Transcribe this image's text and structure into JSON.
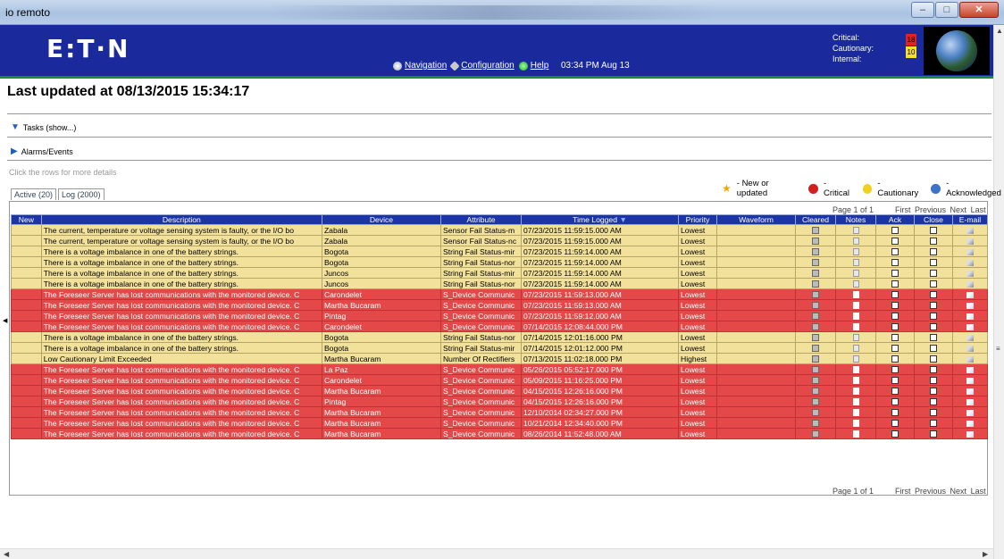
{
  "window": {
    "title": "io remoto"
  },
  "header": {
    "logo": "E:T·N",
    "nav": [
      {
        "label": "Navigation",
        "icon": "navigation-icon"
      },
      {
        "label": "Configuration",
        "icon": "wrench-icon"
      },
      {
        "label": "Help",
        "icon": "help-icon"
      }
    ],
    "clock": "03:34 PM Aug 13",
    "counts": {
      "critical_label": "Critical:",
      "cautionary_label": "Cautionary:",
      "internal_label": "Internal:",
      "critical_value": "18",
      "cautionary_value": "10",
      "critical_color": "#e12222",
      "cautionary_color": "#f5e02a"
    }
  },
  "page": {
    "heading": "Last updated at 08/13/2015 15:34:17",
    "tasks_label": "Tasks (show...)",
    "alarms_label": "Alarms/Events",
    "hint": "Click the rows for more details"
  },
  "legend": {
    "new_label": "- New or updated",
    "critical_label": "- Critical",
    "cautionary_label": "- Cautionary",
    "ack_label": "- Acknowledged",
    "critical_color": "#d21f1f",
    "cautionary_color": "#f0d020",
    "ack_color": "#3c73c8"
  },
  "tabs": [
    {
      "label": "Active (20)"
    },
    {
      "label": "Log (2000)"
    }
  ],
  "pager": {
    "page_text": "Page 1 of 1",
    "first": "First",
    "previous": "Previous",
    "next": "Next",
    "last": "Last"
  },
  "table": {
    "columns": [
      "New",
      "Description",
      "Device",
      "Attribute",
      "Time Logged",
      "Priority",
      "Waveform",
      "Cleared",
      "Notes",
      "Ack",
      "Close",
      "E-mail"
    ],
    "rows": [
      {
        "severity": "caution",
        "description": "The current, temperature or voltage sensing system is faulty, or the I/O bo",
        "device": "Zabala",
        "attribute": "Sensor Fail Status-m",
        "time": "07/23/2015 11:59:15.000 AM",
        "priority": "Lowest"
      },
      {
        "severity": "caution",
        "description": "The current, temperature or voltage sensing system is faulty, or the I/O bo",
        "device": "Zabala",
        "attribute": "Sensor Fail Status-nc",
        "time": "07/23/2015 11:59:15.000 AM",
        "priority": "Lowest"
      },
      {
        "severity": "caution",
        "description": "There is a voltage imbalance in one of the battery strings.",
        "device": "Bogota",
        "attribute": "String Fail Status-mir",
        "time": "07/23/2015 11:59:14.000 AM",
        "priority": "Lowest"
      },
      {
        "severity": "caution",
        "description": "There is a voltage imbalance in one of the battery strings.",
        "device": "Bogota",
        "attribute": "String Fail Status-nor",
        "time": "07/23/2015 11:59:14.000 AM",
        "priority": "Lowest"
      },
      {
        "severity": "caution",
        "description": "There is a voltage imbalance in one of the battery strings.",
        "device": "Juncos",
        "attribute": "String Fail Status-mir",
        "time": "07/23/2015 11:59:14.000 AM",
        "priority": "Lowest"
      },
      {
        "severity": "caution",
        "description": "There is a voltage imbalance in one of the battery strings.",
        "device": "Juncos",
        "attribute": "String Fail Status-nor",
        "time": "07/23/2015 11:59:14.000 AM",
        "priority": "Lowest"
      },
      {
        "severity": "critical",
        "description": "The Foreseer Server has lost communications with the monitored device. C",
        "device": "Carondelet",
        "attribute": "S_Device Communic",
        "time": "07/23/2015 11:59:13.000 AM",
        "priority": "Lowest"
      },
      {
        "severity": "critical",
        "description": "The Foreseer Server has lost communications with the monitored device. C",
        "device": "Martha Bucaram",
        "attribute": "S_Device Communic",
        "time": "07/23/2015 11:59:13.000 AM",
        "priority": "Lowest"
      },
      {
        "severity": "critical",
        "description": "The Foreseer Server has lost communications with the monitored device. C",
        "device": "Pintag",
        "attribute": "S_Device Communic",
        "time": "07/23/2015 11:59:12.000 AM",
        "priority": "Lowest"
      },
      {
        "severity": "critical",
        "description": "The Foreseer Server has lost communications with the monitored device. C",
        "device": "Carondelet",
        "attribute": "S_Device Communic",
        "time": "07/14/2015 12:08:44.000 PM",
        "priority": "Lowest"
      },
      {
        "severity": "caution",
        "description": "There is a voltage imbalance in one of the battery strings.",
        "device": "Bogota",
        "attribute": "String Fail Status-nor",
        "time": "07/14/2015 12:01:16.000 PM",
        "priority": "Lowest"
      },
      {
        "severity": "caution",
        "description": "There is a voltage imbalance in one of the battery strings.",
        "device": "Bogota",
        "attribute": "String Fail Status-mir",
        "time": "07/14/2015 12:01:12.000 PM",
        "priority": "Lowest"
      },
      {
        "severity": "caution",
        "description": "Low Cautionary Limit Exceeded",
        "device": "Martha Bucaram",
        "attribute": "Number Of Rectifiers",
        "time": "07/13/2015 11:02:18.000 PM",
        "priority": "Highest"
      },
      {
        "severity": "critical",
        "description": "The Foreseer Server has lost communications with the monitored device. C",
        "device": "La Paz",
        "attribute": "S_Device Communic",
        "time": "05/26/2015 05:52:17.000 PM",
        "priority": "Lowest"
      },
      {
        "severity": "critical",
        "description": "The Foreseer Server has lost communications with the monitored device. C",
        "device": "Carondelet",
        "attribute": "S_Device Communic",
        "time": "05/09/2015 11:16:25.000 PM",
        "priority": "Lowest"
      },
      {
        "severity": "critical",
        "description": "The Foreseer Server has lost communications with the monitored device. C",
        "device": "Martha Bucaram",
        "attribute": "S_Device Communic",
        "time": "04/15/2015 12:26:16.000 PM",
        "priority": "Lowest"
      },
      {
        "severity": "critical",
        "description": "The Foreseer Server has lost communications with the monitored device. C",
        "device": "Pintag",
        "attribute": "S_Device Communic",
        "time": "04/15/2015 12:26:16.000 PM",
        "priority": "Lowest"
      },
      {
        "severity": "critical",
        "description": "The Foreseer Server has lost communications with the monitored device. C",
        "device": "Martha Bucaram",
        "attribute": "S_Device Communic",
        "time": "12/10/2014 02:34:27.000 PM",
        "priority": "Lowest"
      },
      {
        "severity": "critical",
        "description": "The Foreseer Server has lost communications with the monitored device. C",
        "device": "Martha Bucaram",
        "attribute": "S_Device Communic",
        "time": "10/21/2014 12:34:40.000 PM",
        "priority": "Lowest"
      },
      {
        "severity": "critical",
        "description": "The Foreseer Server has lost communications with the monitored device. C",
        "device": "Martha Bucaram",
        "attribute": "S_Device Communic",
        "time": "08/26/2014 11:52:48.000 AM",
        "priority": "Lowest"
      }
    ]
  }
}
